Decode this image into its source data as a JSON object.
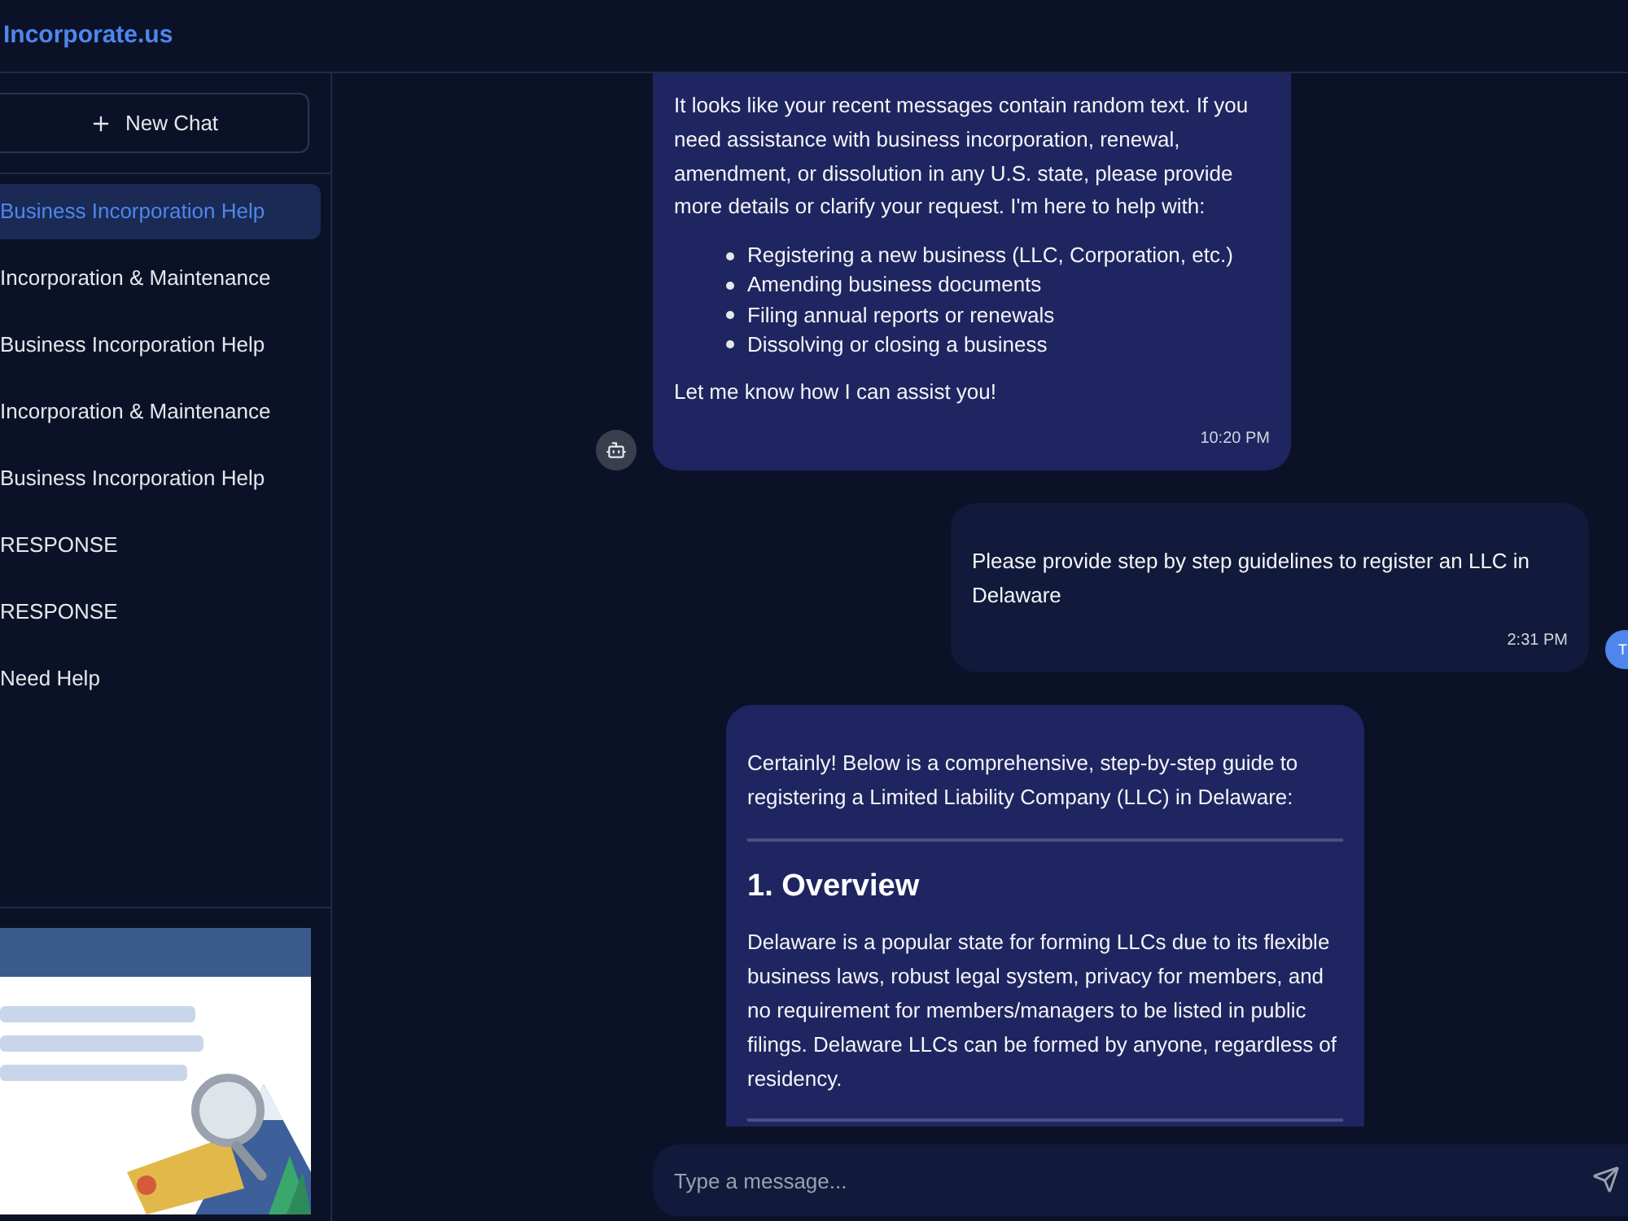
{
  "header": {
    "title": "Incorporate.us"
  },
  "sidebar": {
    "new_chat": "New Chat",
    "items": [
      {
        "label": "Business Incorporation Help",
        "selected": true
      },
      {
        "label": "Incorporation & Maintenance",
        "selected": false
      },
      {
        "label": "Business Incorporation Help",
        "selected": false
      },
      {
        "label": "Incorporation & Maintenance",
        "selected": false
      },
      {
        "label": "Business Incorporation Help",
        "selected": false
      },
      {
        "label": "RESPONSE",
        "selected": false
      },
      {
        "label": "RESPONSE",
        "selected": false
      },
      {
        "label": "Need Help",
        "selected": false
      }
    ]
  },
  "messages": [
    {
      "kind": "bot",
      "blocks": [
        {
          "kind": "p",
          "text": "It looks like your recent messages contain random text. If you need assistance with business incorporation, renewal, amendment, or dissolution in any U.S. state, please provide more details or clarify your request. I'm here to help with:"
        },
        {
          "kind": "list",
          "items": [
            "Registering a new business (LLC, Corporation, etc.)",
            "Amending business documents",
            "Filing annual reports or renewals",
            "Dissolving or closing a business"
          ]
        },
        {
          "kind": "p",
          "text": "Let me know how I can assist you!"
        }
      ],
      "time": "10:20 PM"
    },
    {
      "kind": "user",
      "avatar": "T",
      "blocks": [
        {
          "kind": "p",
          "text": "Please provide step by step guidelines to register an LLC in Delaware"
        }
      ],
      "time": "2:31 PM"
    },
    {
      "kind": "bot",
      "blocks": [
        {
          "kind": "p",
          "text": "Certainly! Below is a comprehensive, step-by-step guide to registering a Limited Liability Company (LLC) in Delaware:"
        },
        {
          "kind": "hr"
        },
        {
          "kind": "h",
          "text": "1. Overview"
        },
        {
          "kind": "p",
          "text": "Delaware is a popular state for forming LLCs due to its flexible business laws, robust legal system, privacy for members, and no requirement for members/managers to be listed in public filings. Delaware LLCs can be formed by anyone, regardless of residency."
        },
        {
          "kind": "hr"
        }
      ]
    }
  ],
  "composer": {
    "placeholder": "Type a message..."
  }
}
